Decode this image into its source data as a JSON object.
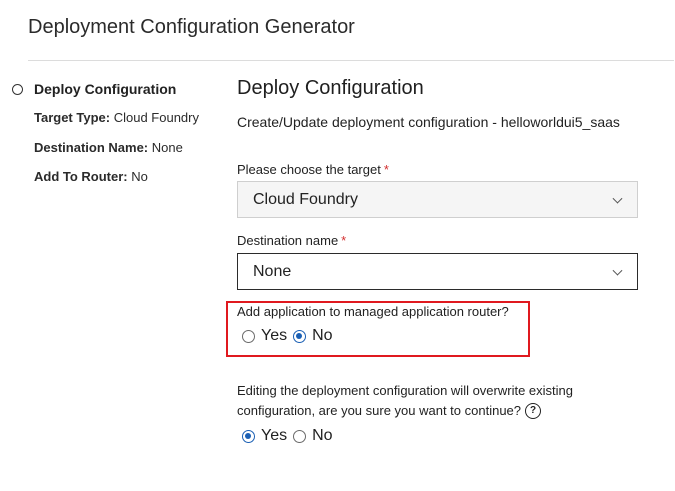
{
  "header": {
    "title": "Deployment Configuration Generator"
  },
  "sidebar": {
    "step_title": "Deploy Configuration",
    "summary": [
      {
        "key": "Target Type:",
        "value": "Cloud Foundry"
      },
      {
        "key": "Destination Name:",
        "value": "None"
      },
      {
        "key": "Add To Router:",
        "value": "No"
      }
    ]
  },
  "main": {
    "title": "Deploy Configuration",
    "subtitle": "Create/Update deployment configuration - helloworldui5_saas",
    "target": {
      "label": "Please choose the target",
      "required_mark": "*",
      "value": "Cloud Foundry"
    },
    "destination": {
      "label": "Destination name",
      "required_mark": "*",
      "value": "None"
    },
    "router": {
      "label": "Add application to managed application router?",
      "options": [
        {
          "label": "Yes",
          "checked": false
        },
        {
          "label": "No",
          "checked": true
        }
      ]
    },
    "overwrite": {
      "line1": "Editing the deployment configuration will overwrite existing",
      "line2": "configuration, are you sure you want to continue?",
      "help_glyph": "?",
      "options": [
        {
          "label": "Yes",
          "checked": true
        },
        {
          "label": "No",
          "checked": false
        }
      ]
    }
  },
  "colors": {
    "accent": "#1a5fb4",
    "highlight": "#e0191f",
    "required": "#d32f2f"
  }
}
